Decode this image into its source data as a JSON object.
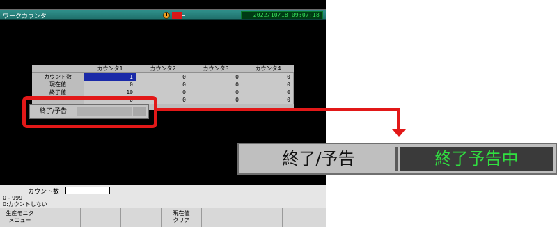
{
  "screen": {
    "title": "ワークカウンタ",
    "datetime": "2022/10/18 09:07:18"
  },
  "table": {
    "columns": [
      "カウンタ1",
      "カウンタ2",
      "カウンタ3",
      "カウンタ4"
    ],
    "rows": [
      {
        "label": "カウント数",
        "values": [
          "1",
          "0",
          "0",
          "0"
        ]
      },
      {
        "label": "現在値",
        "values": [
          "0",
          "0",
          "0",
          "0"
        ]
      },
      {
        "label": "終了値",
        "values": [
          "10",
          "0",
          "0",
          "0"
        ]
      },
      {
        "label": "",
        "values": [
          "0",
          "0",
          "0",
          "0"
        ]
      }
    ],
    "end_warning_label": "終了/予告"
  },
  "input": {
    "label": "カウント数",
    "value": "",
    "range_line1": "0 - 999",
    "range_line2": "0:カウントしない"
  },
  "softkeys": [
    {
      "line1": "生産モニタ",
      "line2": "メニュー"
    },
    {
      "line1": "",
      "line2": ""
    },
    {
      "line1": "",
      "line2": ""
    },
    {
      "line1": "",
      "line2": ""
    },
    {
      "line1": "現在値",
      "line2": "クリア"
    },
    {
      "line1": "",
      "line2": ""
    },
    {
      "line1": "",
      "line2": ""
    },
    {
      "line1": "",
      "line2": ""
    }
  ],
  "zoom": {
    "label": "終了/予告",
    "status": "終了予告中"
  },
  "colors": {
    "highlight": "#e21818",
    "status_text": "#30e040",
    "selected_cell": "#1a2aa8"
  }
}
